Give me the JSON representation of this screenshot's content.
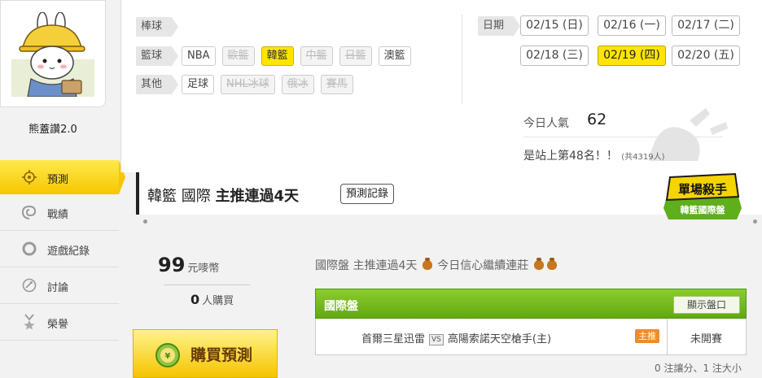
{
  "user": {
    "name": "熊蓋讚2.0"
  },
  "menu": [
    {
      "label": "預測",
      "icon": "target-icon"
    },
    {
      "label": "戰績",
      "icon": "swirl-icon"
    },
    {
      "label": "遊戲紀錄",
      "icon": "ring-icon"
    },
    {
      "label": "討論",
      "icon": "chat-icon"
    },
    {
      "label": "榮譽",
      "icon": "medal-icon"
    }
  ],
  "categories": {
    "baseball": {
      "label": "棒球"
    },
    "basketball": {
      "label": "籃球",
      "items": [
        "NBA",
        "歐籃",
        "韓籃",
        "中籃",
        "日籃",
        "澳籃"
      ],
      "selected": "韓籃",
      "disabled": [
        "歐籃",
        "中籃",
        "日籃"
      ]
    },
    "other": {
      "label": "其他",
      "items": [
        "足球",
        "NHL冰球",
        "俄冰",
        "賽馬"
      ],
      "disabled": [
        "NHL冰球",
        "俄冰",
        "賽馬"
      ]
    }
  },
  "dates": {
    "label": "日期",
    "items": [
      "02/15 (日)",
      "02/16 (一)",
      "02/17 (二)",
      "02/18 (三)",
      "02/19 (四)",
      "02/20 (五)"
    ],
    "selected": "02/19 (四)"
  },
  "popularity": {
    "label": "今日人氣",
    "value": "62",
    "rank_text": "是站上第48名！！",
    "rank_sub": "(共4319人)"
  },
  "heading": {
    "league": "韓籃 國際",
    "streak": "主推連過4天",
    "history_button": "預測記錄"
  },
  "badge": {
    "line1": "單場殺手",
    "line2": "韓籃國際盤"
  },
  "pricing": {
    "price": "99",
    "price_unit": "元嘜幣",
    "buyers": "0",
    "buyers_unit": "人購買",
    "buy_button": "購買預測"
  },
  "recommendation": {
    "part1": "國際盤 主推連過4天",
    "part2": "今日信心繼續連莊"
  },
  "table": {
    "title": "國際盤",
    "show_button": "顯示盤口",
    "rows": [
      {
        "away": "首爾三星迅雷",
        "vs": "VS",
        "home": "高陽索諾天空槍手(主)",
        "tag": "主推",
        "status": "未開賽"
      }
    ]
  },
  "footnote": "0 注讓分、1 注大小",
  "colors": {
    "accent_yellow": "#ffe500",
    "table_green": "#6ab41a",
    "home_tag": "#f08c2a"
  }
}
